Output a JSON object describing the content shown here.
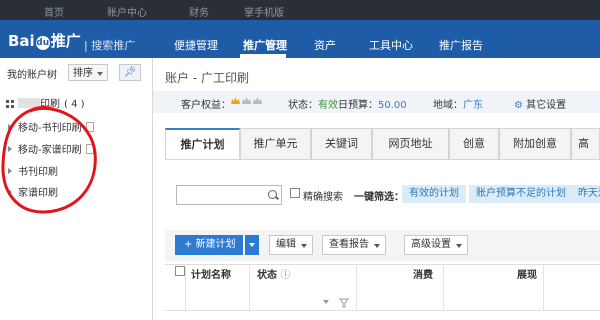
{
  "topbar": {
    "items": [
      "首页",
      "账户中心",
      "财务",
      "掌手机版"
    ]
  },
  "header": {
    "logo_prefix": "Bai",
    "logo_paw": "du",
    "logo_suffix": "推广",
    "subbrand": "| 搜索推广",
    "nav": [
      "便捷管理",
      "推广管理",
      "资产",
      "工具中心",
      "推广报告"
    ],
    "active_nav": "推广管理"
  },
  "sidebar": {
    "title": "我的账户树",
    "sort_label": "排序",
    "pin_icon": "pin-icon",
    "account_name_suffix": "印刷",
    "account_count": "( 4 )",
    "items": [
      "移动-书刊印刷",
      "移动-家谱印刷",
      "书刊印刷",
      "家谱印刷"
    ],
    "annotation_color": "#e0161a"
  },
  "main": {
    "breadcrumb": "账户 - 广工印刷",
    "info": {
      "equity_label": "客户权益：",
      "status_label": "状态：",
      "status_value": "有效",
      "budget_label": "日预算：",
      "budget_value": "50.00",
      "region_label": "地域：",
      "region_value": "广东",
      "settings_label": "其它设置"
    },
    "tabs": [
      "推广计划",
      "推广单元",
      "关键词",
      "网页地址",
      "创意",
      "附加创意",
      "高"
    ],
    "active_tab": "推广计划",
    "filter": {
      "search_placeholder": "",
      "exact_search_label": "精确搜索",
      "quick_filter_label": "一键筛选：",
      "pills": [
        "有效的计划",
        "账户预算不足的计划",
        "昨天消"
      ]
    },
    "toolbar": {
      "new_plan": "+ 新建计划",
      "edit": "编辑",
      "view_report": "查看报告",
      "advanced": "高级设置"
    },
    "table": {
      "headers": [
        "计划名称",
        "状态",
        "消费",
        "展现"
      ]
    }
  },
  "colors": {
    "header_blue": "#1f5ca8",
    "accent_blue": "#2d7bd1",
    "status_green": "#3a9a3a"
  }
}
